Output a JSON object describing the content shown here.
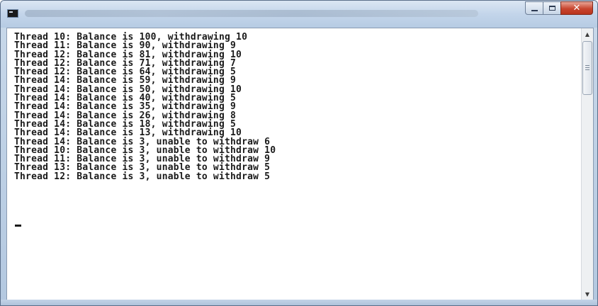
{
  "window": {
    "title": "",
    "buttons": {
      "minimize_icon": "minimize-icon",
      "maximize_icon": "maximize-icon",
      "close_label": "✕"
    }
  },
  "console": {
    "lines": [
      "Thread 10: Balance is 100, withdrawing 10",
      "Thread 11: Balance is 90, withdrawing 9",
      "Thread 12: Balance is 81, withdrawing 10",
      "Thread 12: Balance is 71, withdrawing 7",
      "Thread 12: Balance is 64, withdrawing 5",
      "Thread 14: Balance is 59, withdrawing 9",
      "Thread 14: Balance is 50, withdrawing 10",
      "Thread 14: Balance is 40, withdrawing 5",
      "Thread 14: Balance is 35, withdrawing 9",
      "Thread 14: Balance is 26, withdrawing 8",
      "Thread 14: Balance is 18, withdrawing 5",
      "Thread 14: Balance is 13, withdrawing 10",
      "Thread 14: Balance is 3, unable to withdraw 6",
      "Thread 10: Balance is 3, unable to withdraw 10",
      "Thread 11: Balance is 3, unable to withdraw 9",
      "Thread 13: Balance is 3, unable to withdraw 5",
      "Thread 12: Balance is 3, unable to withdraw 5"
    ]
  },
  "colors": {
    "console_background": "#ffffff",
    "console_text": "#1a1a1a",
    "close_button": "#c8452e"
  }
}
